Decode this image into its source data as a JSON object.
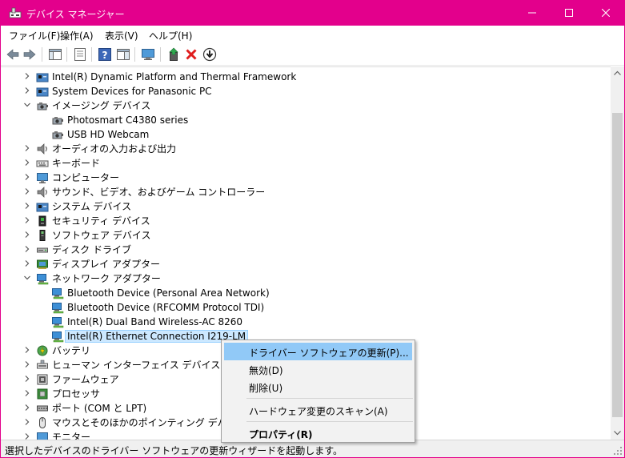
{
  "window": {
    "title": "デバイス マネージャー",
    "accent": "#e3008c"
  },
  "menu": [
    "ファイル(F)",
    "操作(A)",
    "表示(V)",
    "ヘルプ(H)"
  ],
  "toolbar": {
    "icons": [
      "back-arrow-icon",
      "forward-arrow-icon",
      "show-hide-console-tree-icon",
      "properties-icon",
      "help-icon",
      "action-pane-icon",
      "monitor-icon",
      "update-driver-icon",
      "uninstall-icon",
      "scan-hardware-icon"
    ]
  },
  "tree": {
    "rows": [
      {
        "label": "Intel(R) Dynamic Platform and Thermal Framework",
        "level": 1,
        "state": "collapsed",
        "icon": "chip-folder-icon"
      },
      {
        "label": "System Devices for Panasonic PC",
        "level": 1,
        "state": "collapsed",
        "icon": "chip-folder-icon"
      },
      {
        "label": "イメージング デバイス",
        "level": 1,
        "state": "expanded",
        "icon": "camera-icon"
      },
      {
        "label": "Photosmart C4380 series",
        "level": 2,
        "state": "none",
        "icon": "camera-icon"
      },
      {
        "label": "USB HD Webcam",
        "level": 2,
        "state": "none",
        "icon": "camera-icon"
      },
      {
        "label": "オーディオの入力および出力",
        "level": 1,
        "state": "collapsed",
        "icon": "speaker-icon"
      },
      {
        "label": "キーボード",
        "level": 1,
        "state": "collapsed",
        "icon": "keyboard-icon"
      },
      {
        "label": "コンピューター",
        "level": 1,
        "state": "collapsed",
        "icon": "computer-icon"
      },
      {
        "label": "サウンド、ビデオ、およびゲーム コントローラー",
        "level": 1,
        "state": "collapsed",
        "icon": "speaker-icon"
      },
      {
        "label": "システム デバイス",
        "level": 1,
        "state": "collapsed",
        "icon": "chip-folder-icon"
      },
      {
        "label": "セキュリティ デバイス",
        "level": 1,
        "state": "collapsed",
        "icon": "security-device-icon"
      },
      {
        "label": "ソフトウェア デバイス",
        "level": 1,
        "state": "collapsed",
        "icon": "software-device-icon"
      },
      {
        "label": "ディスク ドライブ",
        "level": 1,
        "state": "collapsed",
        "icon": "disk-drive-icon"
      },
      {
        "label": "ディスプレイ アダプター",
        "level": 1,
        "state": "collapsed",
        "icon": "display-adapter-icon"
      },
      {
        "label": "ネットワーク アダプター",
        "level": 1,
        "state": "expanded",
        "icon": "network-adapter-icon"
      },
      {
        "label": "Bluetooth Device (Personal Area Network)",
        "level": 2,
        "state": "none",
        "icon": "network-adapter-icon"
      },
      {
        "label": "Bluetooth Device (RFCOMM Protocol TDI)",
        "level": 2,
        "state": "none",
        "icon": "network-adapter-icon"
      },
      {
        "label": "Intel(R) Dual Band Wireless-AC 8260",
        "level": 2,
        "state": "none",
        "icon": "network-adapter-icon"
      },
      {
        "label": "Intel(R) Ethernet Connection I219-LM",
        "level": 2,
        "state": "selected",
        "icon": "network-adapter-icon"
      },
      {
        "label": "バッテリ",
        "level": 1,
        "state": "collapsed",
        "icon": "battery-icon"
      },
      {
        "label": "ヒューマン インターフェイス デバイス",
        "level": 1,
        "state": "collapsed",
        "icon": "hid-icon"
      },
      {
        "label": "ファームウェア",
        "level": 1,
        "state": "collapsed",
        "icon": "firmware-icon"
      },
      {
        "label": "プロセッサ",
        "level": 1,
        "state": "collapsed",
        "icon": "processor-icon"
      },
      {
        "label": "ポート (COM と LPT)",
        "level": 1,
        "state": "collapsed",
        "icon": "port-icon"
      },
      {
        "label": "マウスとそのほかのポインティング デバイス",
        "level": 1,
        "state": "collapsed",
        "icon": "mouse-icon"
      },
      {
        "label": "モニター",
        "level": 1,
        "state": "collapsed",
        "icon": "computer-icon"
      }
    ]
  },
  "context_menu": {
    "items": [
      {
        "label": "ドライバー ソフトウェアの更新(P)...",
        "highlighted": true,
        "bold": false
      },
      {
        "label": "無効(D)",
        "highlighted": false,
        "bold": false
      },
      {
        "label": "削除(U)",
        "highlighted": false,
        "bold": false
      },
      {
        "separator": true
      },
      {
        "label": "ハードウェア変更のスキャン(A)",
        "highlighted": false,
        "bold": false
      },
      {
        "separator": true
      },
      {
        "label": "プロパティ(R)",
        "highlighted": false,
        "bold": true
      }
    ]
  },
  "status": {
    "text": "選択したデバイスのドライバー ソフトウェアの更新ウィザードを起動します。"
  }
}
